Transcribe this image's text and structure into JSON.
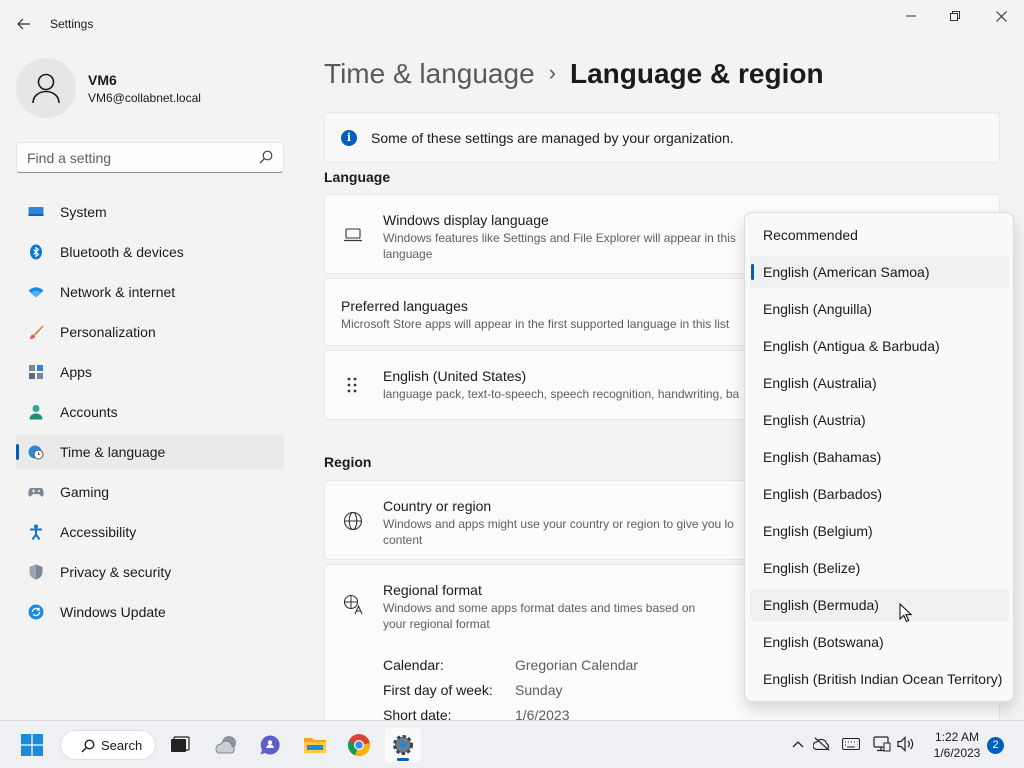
{
  "window": {
    "title": "Settings"
  },
  "user": {
    "name": "VM6",
    "email": "VM6@collabnet.local"
  },
  "search": {
    "placeholder": "Find a setting"
  },
  "sidebar": {
    "items": [
      {
        "label": "System",
        "icon": "system-icon"
      },
      {
        "label": "Bluetooth & devices",
        "icon": "bluetooth-icon"
      },
      {
        "label": "Network & internet",
        "icon": "wifi-icon"
      },
      {
        "label": "Personalization",
        "icon": "brush-icon"
      },
      {
        "label": "Apps",
        "icon": "apps-icon"
      },
      {
        "label": "Accounts",
        "icon": "person-icon"
      },
      {
        "label": "Time & language",
        "icon": "globe-clock-icon",
        "active": true
      },
      {
        "label": "Gaming",
        "icon": "controller-icon"
      },
      {
        "label": "Accessibility",
        "icon": "accessibility-icon"
      },
      {
        "label": "Privacy & security",
        "icon": "shield-icon"
      },
      {
        "label": "Windows Update",
        "icon": "update-icon"
      }
    ]
  },
  "breadcrumb": {
    "parent": "Time & language",
    "separator": "›",
    "current": "Language & region"
  },
  "info": {
    "text": "Some of these settings are managed by your organization."
  },
  "language": {
    "section_title": "Language",
    "display": {
      "title": "Windows display language",
      "desc": "Windows features like Settings and File Explorer will appear in this language"
    },
    "preferred": {
      "title": "Preferred languages",
      "desc": "Microsoft Store apps will appear in the first supported language in this list"
    },
    "english_us": {
      "title": "English (United States)",
      "desc": "language pack, text-to-speech, speech recognition, handwriting, ba"
    }
  },
  "region": {
    "section_title": "Region",
    "country": {
      "title": "Country or region",
      "desc": "Windows and apps might use your country or region to give you lo content"
    },
    "format": {
      "title": "Regional format",
      "desc": "Windows and some apps format dates and times based on your regional format",
      "details": [
        {
          "key": "Calendar:",
          "value": "Gregorian Calendar"
        },
        {
          "key": "First day of week:",
          "value": "Sunday"
        },
        {
          "key": "Short date:",
          "value": "1/6/2023"
        }
      ]
    }
  },
  "dropdown": {
    "header": "Recommended",
    "options": [
      "English (American Samoa)",
      "English (Anguilla)",
      "English (Antigua & Barbuda)",
      "English (Australia)",
      "English (Austria)",
      "English (Bahamas)",
      "English (Barbados)",
      "English (Belgium)",
      "English (Belize)",
      "English (Bermuda)",
      "English (Botswana)",
      "English (British Indian Ocean Territory)"
    ],
    "selected_index": 0,
    "hover_index": 9
  },
  "taskbar": {
    "search_label": "Search",
    "time": "1:22 AM",
    "date": "1/6/2023",
    "notification_count": "2"
  },
  "colors": {
    "accent": "#005fb8"
  }
}
